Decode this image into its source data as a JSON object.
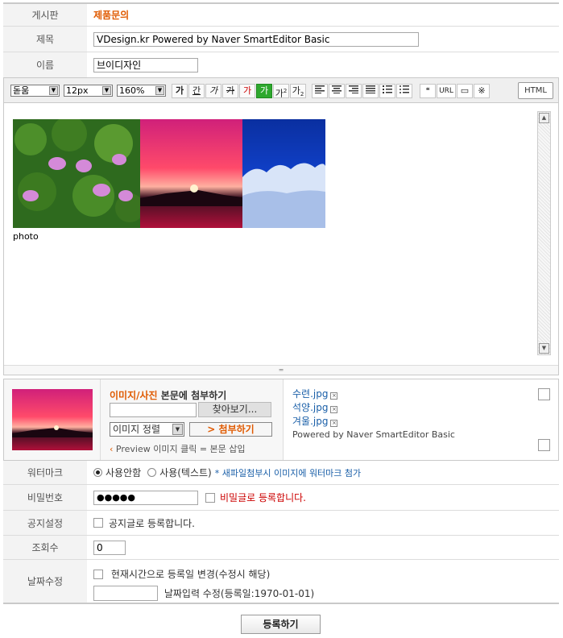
{
  "board": {
    "label": "게시판",
    "value": "제품문의"
  },
  "subject": {
    "label": "제목",
    "value": "VDesign.kr Powered by Naver SmartEditor Basic"
  },
  "name": {
    "label": "이름",
    "value": "브이디자인"
  },
  "toolbar": {
    "font": "돋움",
    "size": "12px",
    "line_height": "160%",
    "bold": "가",
    "underline": "간",
    "italic": "가",
    "strike": "가",
    "font_color": "가",
    "bg_color": "가",
    "superscript": "가",
    "subscript": "가",
    "quote": "❝",
    "url": "URL",
    "table": "▭",
    "special": "※",
    "html": "HTML"
  },
  "editor": {
    "caption": "photo"
  },
  "attach": {
    "title_a": "이미지/사진",
    "title_b": "본문에 첨부하기",
    "browse": "찾아보기...",
    "align": "이미지 정렬",
    "attach_btn": "> 첨부하기",
    "preview_hint": "Preview 이미지 클릭 = 본문 삽입",
    "files": [
      "수련.jpg",
      "석양.jpg",
      "겨울.jpg"
    ],
    "powered": "Powered by Naver SmartEditor Basic"
  },
  "watermark": {
    "label": "워터마크",
    "opt1": "사용안함",
    "opt2": "사용(텍스트)",
    "note": "* 새파일첨부시 이미지에 워터마크 첨가"
  },
  "password": {
    "label": "비밀번호",
    "value": "●●●●●",
    "secret": "비밀글로 등록합니다."
  },
  "notice": {
    "label": "공지설정",
    "option": "공지글로 등록합니다."
  },
  "views": {
    "label": "조회수",
    "value": "0"
  },
  "date": {
    "label": "날짜수정",
    "option": "현재시간으로 등록일 변경(수정시 해당)",
    "hint": "날짜입력 수정(등록일:1970-01-01)"
  },
  "submit": "등록하기",
  "colors": {
    "accent": "#e05a00",
    "link": "#1a5fa8",
    "green": "#2ea82e",
    "red": "#cc0000"
  }
}
